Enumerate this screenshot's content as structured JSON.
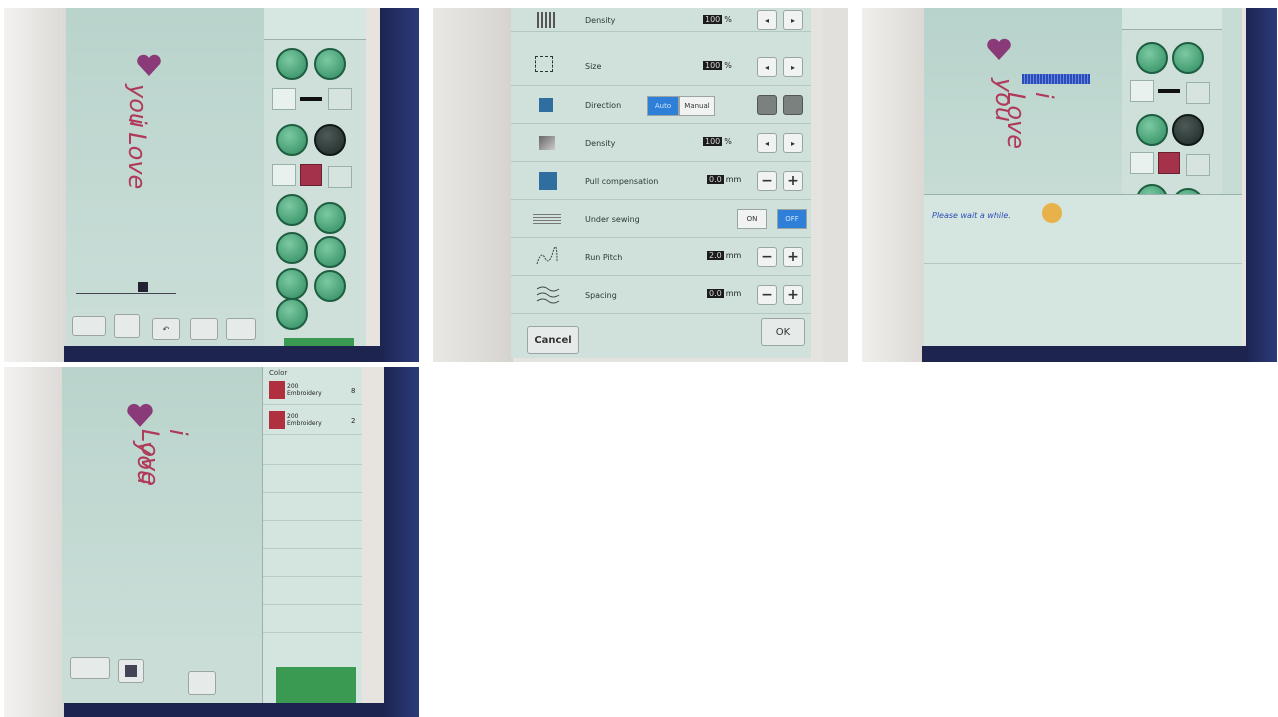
{
  "panel2": {
    "rows": [
      {
        "label": "Density",
        "value": "100",
        "unit": "%"
      },
      {
        "label": "Size",
        "value": "100",
        "unit": "%"
      },
      {
        "label": "Direction",
        "auto": "Auto",
        "manual": "Manual"
      },
      {
        "label": "Density",
        "value": "100",
        "unit": "%"
      },
      {
        "label": "Pull compensation",
        "value": "0.0",
        "unit": "mm"
      },
      {
        "label": "Under sewing",
        "on": "ON",
        "off": "OFF"
      },
      {
        "label": "Run Pitch",
        "value": "2.0",
        "unit": "mm"
      },
      {
        "label": "Spacing",
        "value": "0.0",
        "unit": "mm"
      }
    ],
    "cancel": "Cancel",
    "ok": "OK"
  },
  "panel3": {
    "message": "Please wait a while."
  },
  "panel4": {
    "list_header": "Color",
    "colors": [
      {
        "name": "200 Embroidery",
        "count": "8",
        "hex": "#b03040"
      },
      {
        "name": "200 Embroidery",
        "count": "2",
        "hex": "#b03040"
      }
    ]
  },
  "drawing": {
    "line1": "i Love",
    "line2": "you"
  },
  "colors": {
    "screen": "#c7ddd6",
    "ink": "#b0395a",
    "heart": "#8a3a78",
    "progress": "#2b4db8"
  }
}
